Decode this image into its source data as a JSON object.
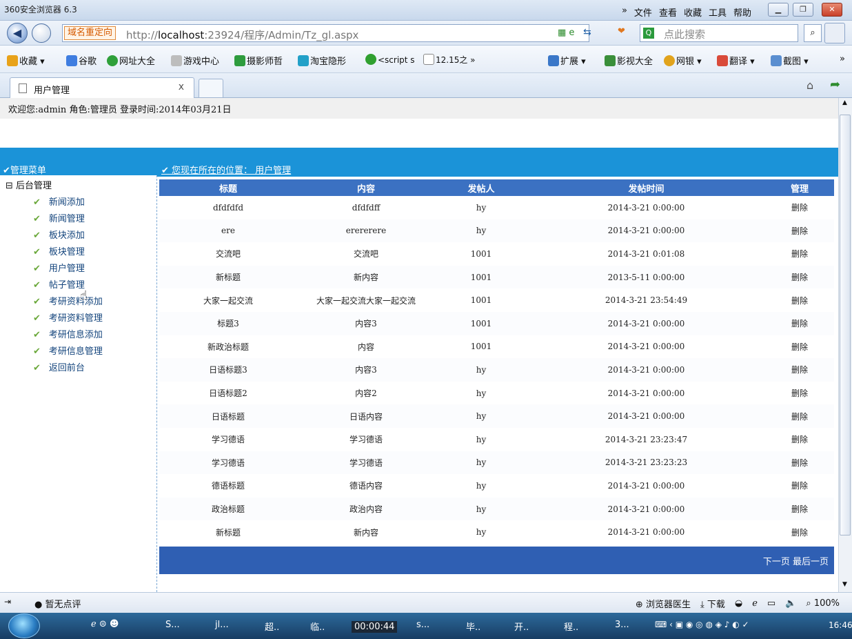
{
  "window": {
    "app_title": "360安全浏览器 6.3",
    "menu": [
      "»",
      "文件",
      "查看",
      "收藏",
      "工具",
      "帮助"
    ]
  },
  "address": {
    "redirect_tag": "域名重定向",
    "url_prefix": "http://",
    "url_host": "localhost",
    "url_rest": ":23924/程序/Admin/Tz_gl.aspx",
    "search_placeholder": "点此搜索"
  },
  "favorites": [
    {
      "label": "收藏 ▾",
      "color": "#e8a21a"
    },
    {
      "label": "谷歌",
      "color": "#3f7de0"
    },
    {
      "label": "网址大全",
      "color": "#2fa03a"
    },
    {
      "label": "游戏中心",
      "color": "#9a9a9a"
    },
    {
      "label": "摄影师哲",
      "color": "#2e9c3e"
    },
    {
      "label": "淘宝隐形",
      "color": "#22a0c8"
    },
    {
      "label": "<script s",
      "color": "#30a030"
    },
    {
      "label": "12.15之 »",
      "color": "#ffffff"
    }
  ],
  "favorites_right": [
    "扩展 ▾",
    "影视大全",
    "网银 ▾",
    "翻译 ▾",
    "截图 ▾",
    "»"
  ],
  "tab": {
    "title": "用户管理",
    "close": "x"
  },
  "page": {
    "welcome": "欢迎您:admin  角色:管理员  登录时间:2014年03月21日",
    "left_header": "✔管理菜单",
    "location": "✔ 您现在所在的位置： 用户管理",
    "tree_root": "⊟ 后台管理",
    "menu": [
      "新闻添加",
      "新闻管理",
      "板块添加",
      "板块管理",
      "用户管理",
      "帖子管理",
      "考研资料添加",
      "考研资料管理",
      "考研信息添加",
      "考研信息管理",
      "返回前台"
    ]
  },
  "table": {
    "headers": [
      "标题",
      "内容",
      "发帖人",
      "发帖时间",
      "管理"
    ],
    "rows": [
      [
        "dfdfdfd",
        "dfdfdff",
        "hy",
        "2014-3-21 0:00:00",
        "删除"
      ],
      [
        "ere",
        "erererere",
        "hy",
        "2014-3-21 0:00:00",
        "删除"
      ],
      [
        "交流吧",
        "交流吧",
        "1001",
        "2014-3-21 0:01:08",
        "删除"
      ],
      [
        "新标题",
        "新内容",
        "1001",
        "2013-5-11 0:00:00",
        "删除"
      ],
      [
        "大家一起交流",
        "大家一起交流大家一起交流",
        "1001",
        "2014-3-21 23:54:49",
        "删除"
      ],
      [
        "标题3",
        "内容3",
        "1001",
        "2014-3-21 0:00:00",
        "删除"
      ],
      [
        "新政治标题",
        "内容",
        "1001",
        "2014-3-21 0:00:00",
        "删除"
      ],
      [
        "日语标题3",
        "内容3",
        "hy",
        "2014-3-21 0:00:00",
        "删除"
      ],
      [
        "日语标题2",
        "内容2",
        "hy",
        "2014-3-21 0:00:00",
        "删除"
      ],
      [
        "日语标题",
        "日语内容",
        "hy",
        "2014-3-21 0:00:00",
        "删除"
      ],
      [
        "学习德语",
        "学习德语",
        "hy",
        "2014-3-21 23:23:47",
        "删除"
      ],
      [
        "学习德语",
        "学习德语",
        "hy",
        "2014-3-21 23:23:23",
        "删除"
      ],
      [
        "德语标题",
        "德语内容",
        "hy",
        "2014-3-21 0:00:00",
        "删除"
      ],
      [
        "政治标题",
        "政治内容",
        "hy",
        "2014-3-21 0:00:00",
        "删除"
      ],
      [
        "新标题",
        "新内容",
        "hy",
        "2014-3-21 0:00:00",
        "删除"
      ]
    ],
    "pager": "下一页 最后一页"
  },
  "status": {
    "left": "暂无点评",
    "right": [
      "浏览器医生",
      "下载",
      "100%"
    ]
  },
  "taskbar": {
    "items": [
      "S...",
      "jl...",
      "超..",
      "临..",
      "s...",
      "毕..",
      "开..",
      "程..",
      "3..."
    ],
    "recording_time": "00:00:44",
    "time": "16:46"
  }
}
